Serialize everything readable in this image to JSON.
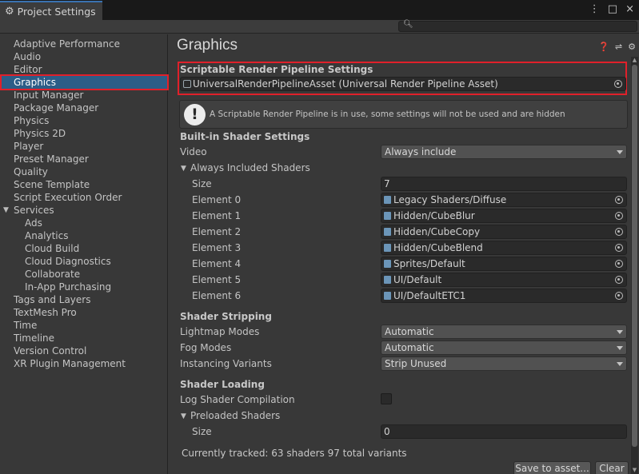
{
  "window": {
    "tab_title": "Project Settings",
    "more_icon": "⋮",
    "maximize_icon": "□",
    "close_icon": "×"
  },
  "search": {
    "placeholder": ""
  },
  "sidebar": {
    "items": [
      {
        "label": "Adaptive Performance",
        "indent": 0,
        "selected": false
      },
      {
        "label": "Audio",
        "indent": 0,
        "selected": false
      },
      {
        "label": "Editor",
        "indent": 0,
        "selected": false
      },
      {
        "label": "Graphics",
        "indent": 0,
        "selected": true
      },
      {
        "label": "Input Manager",
        "indent": 0,
        "selected": false
      },
      {
        "label": "Package Manager",
        "indent": 0,
        "selected": false
      },
      {
        "label": "Physics",
        "indent": 0,
        "selected": false
      },
      {
        "label": "Physics 2D",
        "indent": 0,
        "selected": false
      },
      {
        "label": "Player",
        "indent": 0,
        "selected": false
      },
      {
        "label": "Preset Manager",
        "indent": 0,
        "selected": false
      },
      {
        "label": "Quality",
        "indent": 0,
        "selected": false
      },
      {
        "label": "Scene Template",
        "indent": 0,
        "selected": false
      },
      {
        "label": "Script Execution Order",
        "indent": 0,
        "selected": false
      },
      {
        "label": "Services",
        "indent": 0,
        "selected": false,
        "foldout": true
      },
      {
        "label": "Ads",
        "indent": 1,
        "selected": false
      },
      {
        "label": "Analytics",
        "indent": 1,
        "selected": false
      },
      {
        "label": "Cloud Build",
        "indent": 1,
        "selected": false
      },
      {
        "label": "Cloud Diagnostics",
        "indent": 1,
        "selected": false
      },
      {
        "label": "Collaborate",
        "indent": 1,
        "selected": false
      },
      {
        "label": "In-App Purchasing",
        "indent": 1,
        "selected": false
      },
      {
        "label": "Tags and Layers",
        "indent": 0,
        "selected": false
      },
      {
        "label": "TextMesh Pro",
        "indent": 0,
        "selected": false
      },
      {
        "label": "Time",
        "indent": 0,
        "selected": false
      },
      {
        "label": "Timeline",
        "indent": 0,
        "selected": false
      },
      {
        "label": "Version Control",
        "indent": 0,
        "selected": false
      },
      {
        "label": "XR Plugin Management",
        "indent": 0,
        "selected": false
      }
    ]
  },
  "main": {
    "title": "Graphics",
    "srp": {
      "heading": "Scriptable Render Pipeline Settings",
      "asset": "UniversalRenderPipelineAsset (Universal Render Pipeline Asset)"
    },
    "help_message": "A Scriptable Render Pipeline is in use, some settings will not be used and are hidden",
    "builtin": {
      "heading": "Built-in Shader Settings",
      "video_label": "Video",
      "video_value": "Always include",
      "always_included_label": "Always Included Shaders",
      "size_label": "Size",
      "size_value": "7",
      "elements": [
        {
          "label": "Element 0",
          "value": "Legacy Shaders/Diffuse"
        },
        {
          "label": "Element 1",
          "value": "Hidden/CubeBlur"
        },
        {
          "label": "Element 2",
          "value": "Hidden/CubeCopy"
        },
        {
          "label": "Element 3",
          "value": "Hidden/CubeBlend"
        },
        {
          "label": "Element 4",
          "value": "Sprites/Default"
        },
        {
          "label": "Element 5",
          "value": "UI/Default"
        },
        {
          "label": "Element 6",
          "value": "UI/DefaultETC1"
        }
      ]
    },
    "stripping": {
      "heading": "Shader Stripping",
      "lightmap_label": "Lightmap Modes",
      "lightmap_value": "Automatic",
      "fog_label": "Fog Modes",
      "fog_value": "Automatic",
      "instancing_label": "Instancing Variants",
      "instancing_value": "Strip Unused"
    },
    "loading": {
      "heading": "Shader Loading",
      "log_label": "Log Shader Compilation",
      "log_checked": false,
      "preloaded_label": "Preloaded Shaders",
      "size_label": "Size",
      "size_value": "0"
    },
    "status": "Currently tracked: 63 shaders 97 total variants",
    "save_button": "Save to asset...",
    "clear_button": "Clear"
  },
  "colors": {
    "selection": "#2c5d87",
    "highlight": "#e0202a",
    "background": "#383838"
  }
}
